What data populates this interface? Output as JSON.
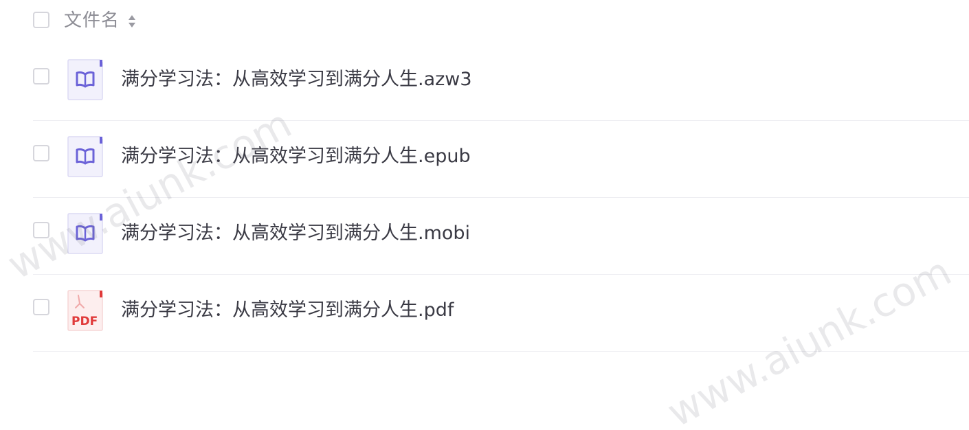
{
  "header": {
    "label": "文件名"
  },
  "files": [
    {
      "name": "满分学习法：从高效学习到满分人生.azw3",
      "icon": "ebook-file-icon"
    },
    {
      "name": "满分学习法：从高效学习到满分人生.epub",
      "icon": "ebook-file-icon"
    },
    {
      "name": "满分学习法：从高效学习到满分人生.mobi",
      "icon": "ebook-file-icon"
    },
    {
      "name": "满分学习法：从高效学习到满分人生.pdf",
      "icon": "pdf-file-icon",
      "icon_text": "PDF"
    }
  ],
  "watermarks": [
    "www.aiunk.com",
    "www.aiunk.com"
  ],
  "colors": {
    "ebook_accent": "#6b62d8",
    "ebook_bg": "#f2f1fc",
    "pdf_accent": "#e03a3a",
    "pdf_bg": "#fdeeee",
    "text": "#3a3a44",
    "header_text": "#8c8c94"
  }
}
